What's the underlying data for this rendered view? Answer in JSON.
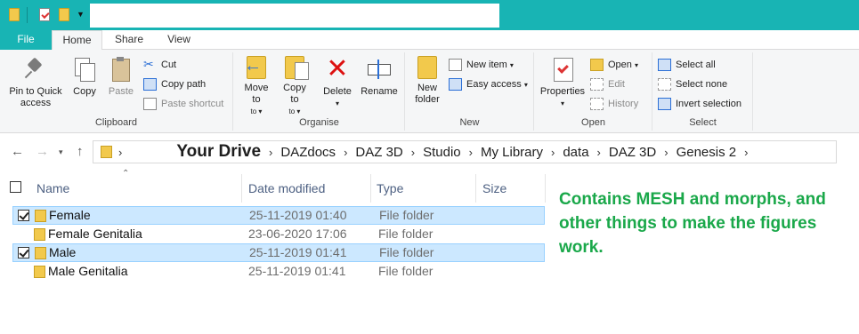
{
  "titlebar": {
    "qat_icons": [
      "folder-icon",
      "properties-icon",
      "new-folder-icon",
      "customize-arrow"
    ],
    "color": "#18b4b4"
  },
  "tabs": {
    "file": "File",
    "home": "Home",
    "share": "Share",
    "view": "View"
  },
  "ribbon": {
    "clipboard": {
      "label": "Clipboard",
      "pin": "Pin to Quick access",
      "copy": "Copy",
      "paste": "Paste",
      "cut": "Cut",
      "copy_path": "Copy path",
      "paste_shortcut": "Paste shortcut"
    },
    "organise": {
      "label": "Organise",
      "move_to": "Move to",
      "copy_to": "Copy to",
      "delete": "Delete",
      "rename": "Rename"
    },
    "new": {
      "label": "New",
      "new_folder": "New folder",
      "new_item": "New item",
      "easy_access": "Easy access"
    },
    "open": {
      "label": "Open",
      "properties": "Properties",
      "open": "Open",
      "edit": "Edit",
      "history": "History"
    },
    "select": {
      "label": "Select",
      "select_all": "Select all",
      "select_none": "Select none",
      "invert_selection": "Invert selection"
    }
  },
  "address": {
    "crumbs": [
      "Your Drive",
      "DAZdocs",
      "DAZ 3D",
      "Studio",
      "My Library",
      "data",
      "DAZ 3D",
      "Genesis 2"
    ]
  },
  "columns": {
    "name": "Name",
    "date_modified": "Date modified",
    "type": "Type",
    "size": "Size"
  },
  "files": [
    {
      "name": "Female",
      "date": "25-11-2019 01:40",
      "type": "File folder",
      "selected": true
    },
    {
      "name": "Female Genitalia",
      "date": "23-06-2020 17:06",
      "type": "File folder",
      "selected": false
    },
    {
      "name": "Male",
      "date": "25-11-2019 01:41",
      "type": "File folder",
      "selected": true
    },
    {
      "name": "Male Genitalia",
      "date": "25-11-2019 01:41",
      "type": "File folder",
      "selected": false
    }
  ],
  "annotation": {
    "text": "Contains MESH and morphs, and other things to make the figures work.",
    "color": "#1aa84a"
  }
}
